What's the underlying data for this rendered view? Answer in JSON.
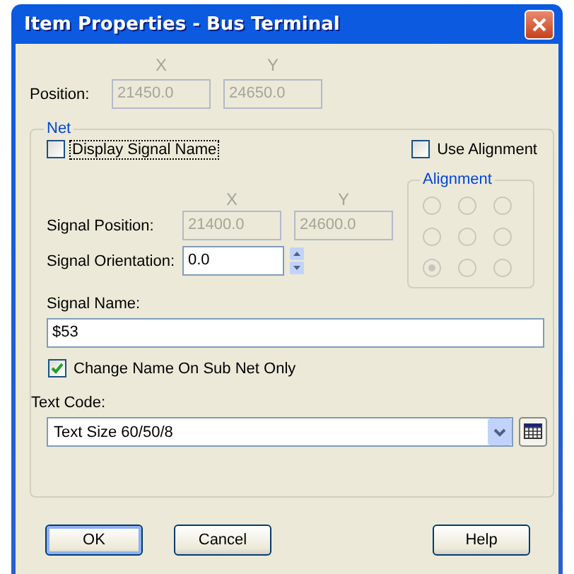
{
  "window": {
    "title": "Item Properties - Bus Terminal"
  },
  "position": {
    "label": "Position:",
    "x_header": "X",
    "y_header": "Y",
    "x_value": "21450.0",
    "y_value": "24650.0",
    "disabled": true
  },
  "net": {
    "legend": "Net",
    "display_signal_name": {
      "label": "Display Signal Name",
      "checked": false,
      "focused": true
    },
    "use_alignment": {
      "label": "Use Alignment",
      "checked": false,
      "focused": false
    },
    "alignment": {
      "legend": "Alignment",
      "disabled": true,
      "options": [
        {
          "selected": false
        },
        {
          "selected": false
        },
        {
          "selected": false
        },
        {
          "selected": false
        },
        {
          "selected": false
        },
        {
          "selected": false
        },
        {
          "selected": true
        },
        {
          "selected": false
        },
        {
          "selected": false
        }
      ]
    },
    "signal_position": {
      "label": "Signal Position:",
      "x_header": "X",
      "y_header": "Y",
      "x_value": "21400.0",
      "y_value": "24600.0",
      "disabled": true
    },
    "signal_orientation": {
      "label": "Signal Orientation:",
      "value": "0.0"
    },
    "signal_name": {
      "label": "Signal Name:",
      "value": "$53"
    },
    "change_name": {
      "label": "Change Name On Sub Net Only",
      "checked": true,
      "focused": false
    },
    "text_code": {
      "label": "Text Code:",
      "value": "Text Size 60/50/8"
    }
  },
  "buttons": [
    {
      "label": "OK",
      "default": true
    },
    {
      "label": "Cancel",
      "default": false
    },
    {
      "label": "Help",
      "default": false
    }
  ]
}
